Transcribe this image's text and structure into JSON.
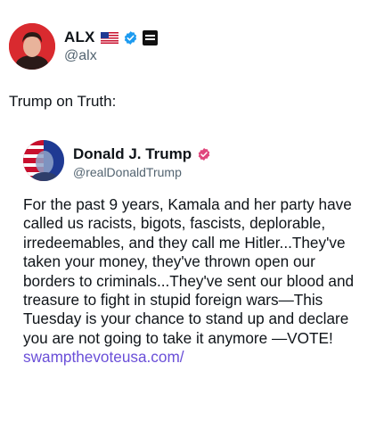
{
  "author": {
    "name": "ALX",
    "handle": "@alx",
    "flag_icon": "us-flag-icon",
    "verified_icon": "verified-badge-icon",
    "affiliate_badge_icon": "affiliate-badge-icon",
    "verified_color": "#1d9bf0"
  },
  "post": {
    "text": "Trump on Truth:"
  },
  "quote": {
    "name": "Donald J. Trump",
    "handle": "@realDonaldTrump",
    "verified_icon": "truth-verified-badge-icon",
    "verified_color": "#e0467c",
    "body_text": "For the past 9 years, Kamala and her party have called us racists, bigots, fascists, deplorable, irredeemables, and they call me Hitler...They've taken your money, they've thrown open our borders to criminals...They've sent our blood and treasure to fight in stupid foreign wars—This Tuesday is your chance to stand up and declare you are not going to take it anymore —VOTE! ",
    "link_text": "swampthevoteusa.com/",
    "link_color": "#6a4fd8"
  }
}
